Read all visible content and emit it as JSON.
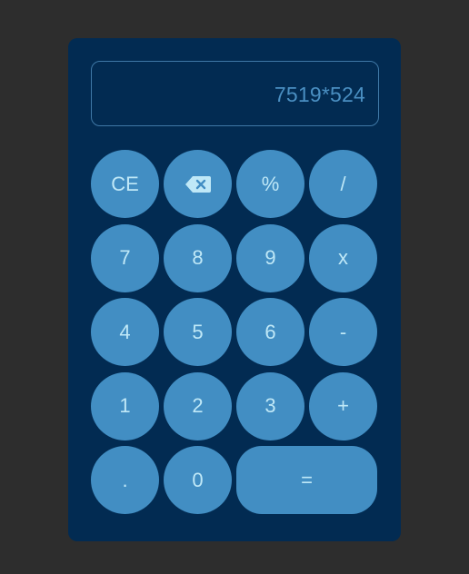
{
  "display": {
    "expression": "7519*524"
  },
  "keys": [
    {
      "name": "clear-entry-button",
      "label": "CE"
    },
    {
      "name": "backspace-button",
      "icon": "backspace-icon"
    },
    {
      "name": "percent-button",
      "label": "%"
    },
    {
      "name": "divide-button",
      "label": "/"
    },
    {
      "name": "digit-7-button",
      "label": "7"
    },
    {
      "name": "digit-8-button",
      "label": "8"
    },
    {
      "name": "digit-9-button",
      "label": "9"
    },
    {
      "name": "multiply-button",
      "label": "x"
    },
    {
      "name": "digit-4-button",
      "label": "4"
    },
    {
      "name": "digit-5-button",
      "label": "5"
    },
    {
      "name": "digit-6-button",
      "label": "6"
    },
    {
      "name": "subtract-button",
      "label": "-"
    },
    {
      "name": "digit-1-button",
      "label": "1"
    },
    {
      "name": "digit-2-button",
      "label": "2"
    },
    {
      "name": "digit-3-button",
      "label": "3"
    },
    {
      "name": "add-button",
      "label": "+"
    },
    {
      "name": "decimal-point-button",
      "label": "."
    },
    {
      "name": "digit-0-button",
      "label": "0"
    },
    {
      "name": "equals-button",
      "label": "=",
      "wide": true
    }
  ],
  "colors": {
    "page_background": "#2d2d2d",
    "calculator_body": "#022b52",
    "key_fill": "#428ec3",
    "key_text": "#bfe8f7",
    "display_text": "#4a8fc2",
    "display_border": "#3f78a6"
  }
}
